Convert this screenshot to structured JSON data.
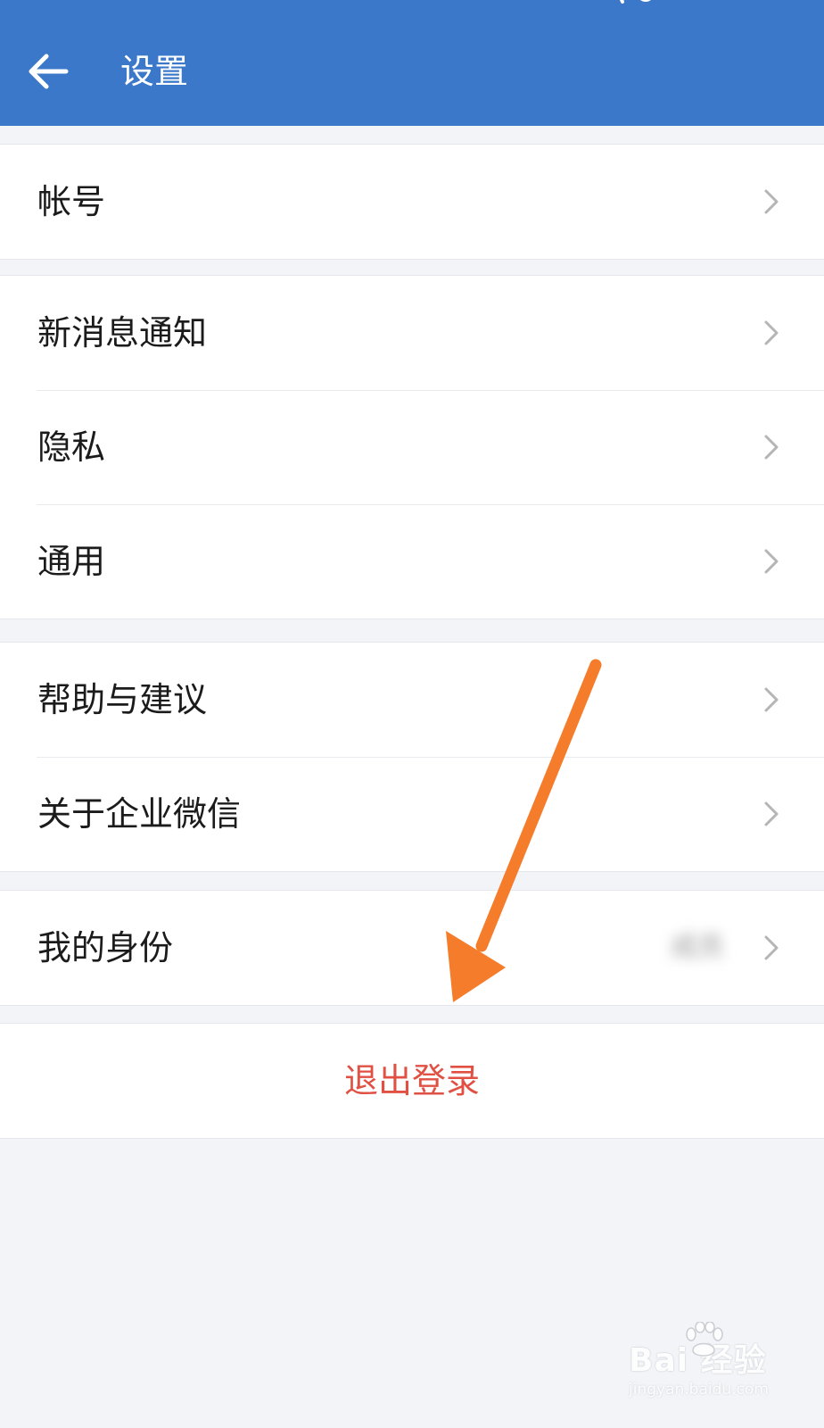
{
  "header": {
    "title": "设置",
    "background_color": "#3b78c9",
    "back_icon": "arrow-left-icon"
  },
  "groups": [
    {
      "items": [
        {
          "label": "帐号"
        }
      ]
    },
    {
      "items": [
        {
          "label": "新消息通知"
        },
        {
          "label": "隐私"
        },
        {
          "label": "通用"
        }
      ]
    },
    {
      "items": [
        {
          "label": "帮助与建议"
        },
        {
          "label": "关于企业微信"
        }
      ]
    },
    {
      "items": [
        {
          "label": "我的身份",
          "value": "成员"
        }
      ]
    }
  ],
  "logout": {
    "label": "退出登录",
    "color": "#e05144"
  },
  "annotation": {
    "arrow_color": "#f57c2b"
  },
  "watermark": {
    "brand": "Bai  经验",
    "url": "jingyan.baidu.com"
  },
  "colors": {
    "page_background": "#f3f4f8",
    "row_background": "#ffffff",
    "chevron": "#b5b5b8"
  }
}
